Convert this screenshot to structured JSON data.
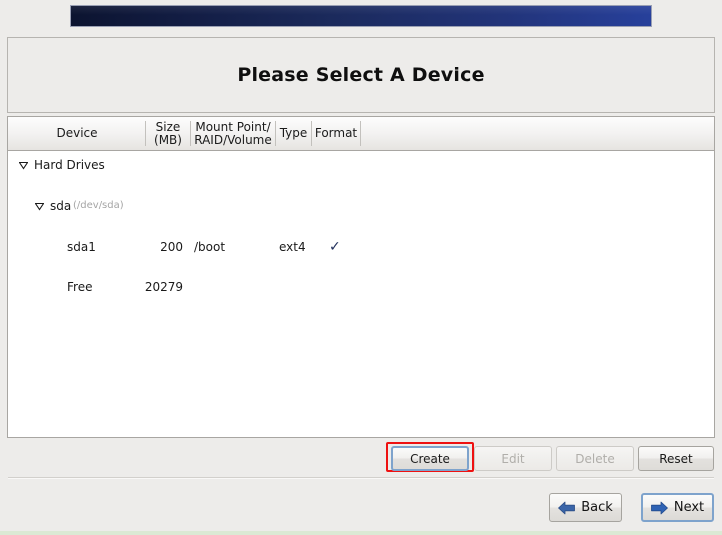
{
  "banner": {
    "name": "installer-banner"
  },
  "title": {
    "text": "Please Select A Device"
  },
  "table": {
    "columns": [
      {
        "label": "Device"
      },
      {
        "label": "Size\n(MB)",
        "line1": "Size",
        "line2": "(MB)"
      },
      {
        "label": "Mount Point/\nRAID/Volume",
        "line1": "Mount Point/",
        "line2": "RAID/Volume"
      },
      {
        "label": "Type"
      },
      {
        "label": "Format"
      }
    ],
    "rows": [
      {
        "kind": "group",
        "device": "Hard Drives",
        "detail": "",
        "size": "",
        "mount": "",
        "type": "",
        "format": ""
      },
      {
        "kind": "drive",
        "device": "sda",
        "detail": "(/dev/sda)",
        "size": "",
        "mount": "",
        "type": "",
        "format": ""
      },
      {
        "kind": "partition",
        "device": "sda1",
        "detail": "",
        "size": "200",
        "mount": "/boot",
        "type": "ext4",
        "format": "✓"
      },
      {
        "kind": "free",
        "device": "Free",
        "detail": "",
        "size": "20279",
        "mount": "",
        "type": "",
        "format": ""
      }
    ]
  },
  "actions": {
    "create": "Create",
    "edit": "Edit",
    "delete": "Delete",
    "reset": "Reset"
  },
  "nav": {
    "back": "Back",
    "next": "Next"
  },
  "colors": {
    "banner_dark": "#0c1430",
    "banner_light": "#27409b",
    "highlight_red": "#ee1111",
    "focus_blue": "#7ea3cc",
    "arrow_blue": "#2b5fa8",
    "check_navy": "#22305c"
  }
}
